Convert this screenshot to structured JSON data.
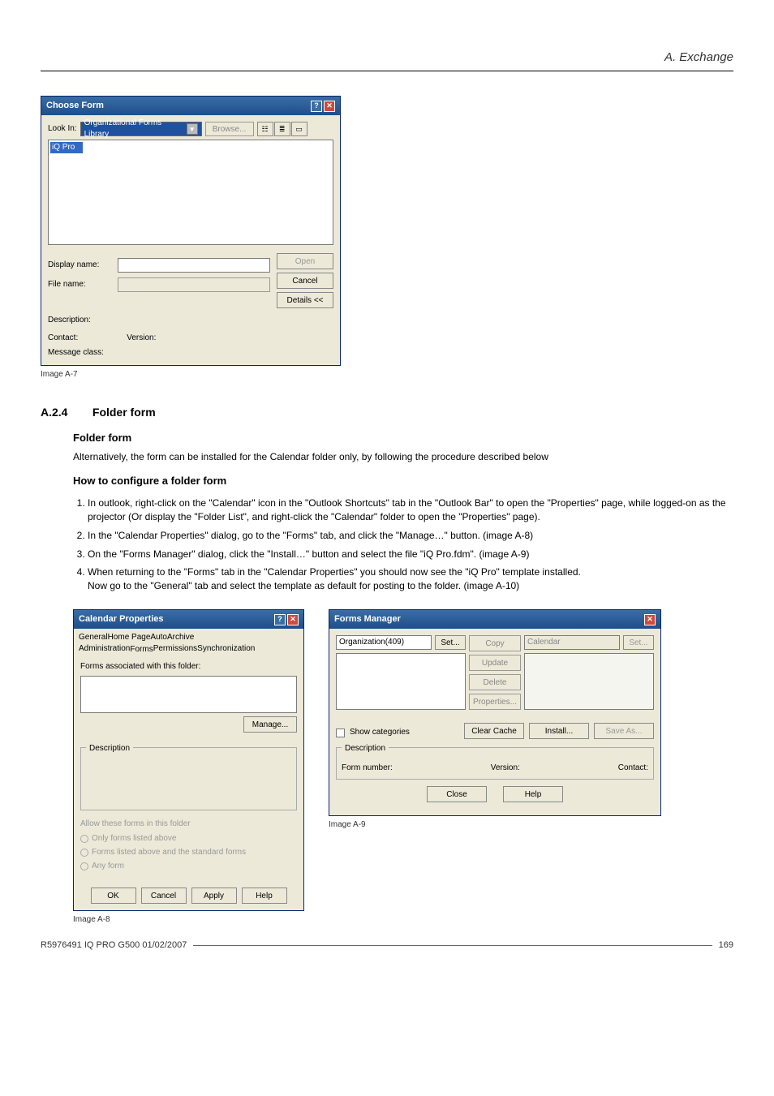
{
  "page_header": "A. Exchange",
  "choose_form": {
    "title": "Choose Form",
    "lookin_label": "Look In:",
    "lookin_value": "Organizational Forms Library",
    "browse_btn": "Browse...",
    "list_item": "iQ Pro",
    "displayname_label": "Display name:",
    "filename_label": "File name:",
    "open_btn": "Open",
    "cancel_btn": "Cancel",
    "details_btn": "Details <<",
    "description_label": "Description:",
    "contact_label": "Contact:",
    "version_label": "Version:",
    "msgclass_label": "Message class:"
  },
  "caption_a7": "Image A-7",
  "section": {
    "num": "A.2.4",
    "title": "Folder form",
    "subhead1": "Folder form",
    "para1": "Alternatively, the form can be installed for the Calendar folder only, by following the procedure described below",
    "subhead2": "How to configure a folder form",
    "step1": "In outlook, right-click on the \"Calendar\" icon in the \"Outlook Shortcuts\" tab in the \"Outlook Bar\" to open the \"Properties\" page, while logged-on as the projector (Or display the \"Folder List\", and right-click the \"Calendar\" folder to open the \"Properties\" page).",
    "step2": "In the \"Calendar Properties\" dialog, go to the \"Forms\" tab, and click the \"Manage…\" button. (image A-8)",
    "step3": "On the \"Forms Manager\" dialog, click the \"Install…\" button and select the file \"iQ Pro.fdm\". (image A-9)",
    "step4a": "When returning to the \"Forms\" tab in the \"Calendar Properties\" you should now see the \"iQ Pro\" template installed.",
    "step4b": "Now go to the \"General\" tab and select the template as default for posting to the folder. (image A-10)"
  },
  "cal_props": {
    "title": "Calendar Properties",
    "tabs_row1": [
      "General",
      "Home Page",
      "AutoArchive"
    ],
    "tabs_row2": [
      "Administration",
      "Forms",
      "Permissions",
      "Synchronization"
    ],
    "forms_assoc_label": "Forms associated with this folder:",
    "manage_btn": "Manage...",
    "desc_legend": "Description",
    "allow_legend": "Allow these forms in this folder",
    "radio1": "Only forms listed above",
    "radio2": "Forms listed above and the standard forms",
    "radio3": "Any form",
    "ok": "OK",
    "cancel": "Cancel",
    "apply": "Apply",
    "help": "Help"
  },
  "caption_a8": "Image A-8",
  "forms_mgr": {
    "title": "Forms Manager",
    "left_head": "Organization(409)",
    "right_head": "Calendar",
    "set_btn": "Set...",
    "copy": "Copy",
    "update": "Update",
    "delete": "Delete",
    "props": "Properties...",
    "show_cat": "Show categories",
    "clear_cache": "Clear Cache",
    "install": "Install...",
    "save_as": "Save As...",
    "desc_legend": "Description",
    "formnum": "Form number:",
    "version": "Version:",
    "contact": "Contact:",
    "close": "Close",
    "help": "Help"
  },
  "caption_a9": "Image A-9",
  "footer_left": "R5976491 IQ PRO G500 01/02/2007",
  "footer_right": "169"
}
